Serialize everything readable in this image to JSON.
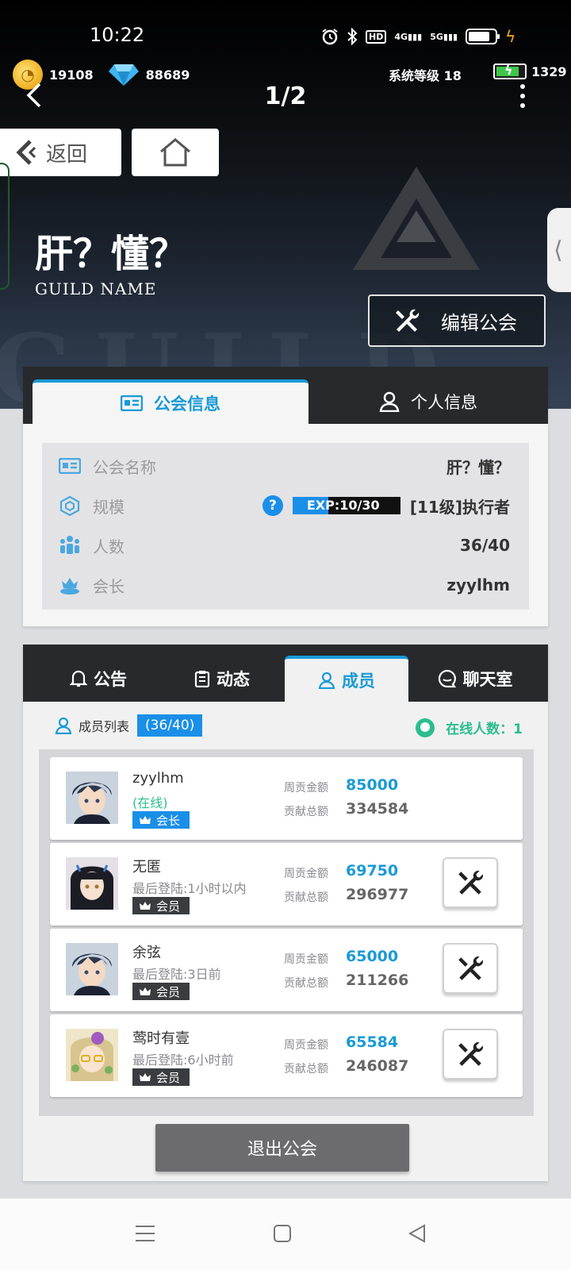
{
  "status_bar": {
    "time": "10:22",
    "net1": "4G",
    "net2": "5G",
    "hd": "HD"
  },
  "currency": {
    "coins": "19108",
    "gems": "88689"
  },
  "system_level": "系统等级 18",
  "energy": "1329",
  "page_indicator": "1/2",
  "buttons": {
    "back": "返回",
    "edit_guild": "编辑公会",
    "leave_guild": "退出公会"
  },
  "guild": {
    "title": "肝？懂？",
    "subtitle": "GUILD NAME",
    "watermark": "GUILD"
  },
  "info_tabs": {
    "guild_info": "公会信息",
    "personal_info": "个人信息"
  },
  "info": {
    "name_label": "公会名称",
    "name_value": "肝？懂？",
    "scale_label": "规模",
    "exp_text": "EXP:10/30",
    "exp_fraction": 0.333,
    "level_text": "[11级]执行者",
    "members_label": "人数",
    "members_value": "36/40",
    "leader_label": "会长",
    "leader_value": "zyylhm"
  },
  "member_tabs": {
    "notice": "公告",
    "activity": "动态",
    "members": "成员",
    "chat": "聊天室"
  },
  "member_list": {
    "title": "成员列表",
    "count": "(36/40)",
    "online_label": "在线人数：1",
    "weekly_label": "周贡金额",
    "total_label": "贡献总额",
    "items": [
      {
        "name": "zyylhm",
        "status": "(在线)",
        "role": "会长",
        "weekly": "85000",
        "total": "334584"
      },
      {
        "name": "无匿",
        "status": "最后登陆:1小时以内",
        "role": "会员",
        "weekly": "69750",
        "total": "296977"
      },
      {
        "name": "余弦",
        "status": "最后登陆:3日前",
        "role": "会员",
        "weekly": "65000",
        "total": "211266"
      },
      {
        "name": "莺时有壹",
        "status": "最后登陆:6小时前",
        "role": "会员",
        "weekly": "65584",
        "total": "246087"
      }
    ]
  },
  "colors": {
    "accent": "#1a9ad6",
    "online": "#2bbd8e",
    "dark": "#27292d"
  }
}
